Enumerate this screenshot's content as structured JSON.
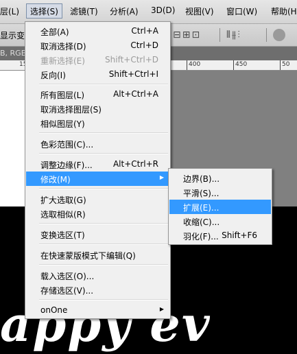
{
  "menubar": {
    "items": [
      "层(L)",
      "选择(S)",
      "滤镜(T)",
      "分析(A)",
      "3D(D)",
      "视图(V)",
      "窗口(W)",
      "帮助(H)"
    ]
  },
  "options_bar": {
    "show_transform_label": "显示变",
    "align_icons": "⊟⊞⊡",
    "distribute_icons": "⫴⫵⫶"
  },
  "document_tab": {
    "info": "B, RGB/"
  },
  "ruler": {
    "labels": [
      "15",
      "400",
      "450",
      "50"
    ]
  },
  "canvas": {
    "text_art": "appy ev"
  },
  "select_menu": {
    "items": [
      {
        "label": "全部(A)",
        "shortcut": "Ctrl+A"
      },
      {
        "label": "取消选择(D)",
        "shortcut": "Ctrl+D"
      },
      {
        "label": "重新选择(E)",
        "shortcut": "Shift+Ctrl+D",
        "disabled": true
      },
      {
        "label": "反向(I)",
        "shortcut": "Shift+Ctrl+I"
      },
      {
        "label": "所有图层(L)",
        "shortcut": "Alt+Ctrl+A"
      },
      {
        "label": "取消选择图层(S)",
        "shortcut": ""
      },
      {
        "label": "相似图层(Y)",
        "shortcut": ""
      },
      {
        "label": "色彩范围(C)...",
        "shortcut": ""
      },
      {
        "label": "调整边缘(F)...",
        "shortcut": "Alt+Ctrl+R"
      },
      {
        "label": "修改(M)",
        "shortcut": "",
        "submenu": true,
        "highlighted": true
      },
      {
        "label": "扩大选取(G)",
        "shortcut": ""
      },
      {
        "label": "选取相似(R)",
        "shortcut": ""
      },
      {
        "label": "变换选区(T)",
        "shortcut": ""
      },
      {
        "label": "在快速蒙版模式下编辑(Q)",
        "shortcut": ""
      },
      {
        "label": "载入选区(O)...",
        "shortcut": ""
      },
      {
        "label": "存储选区(V)...",
        "shortcut": ""
      },
      {
        "label": "onOne",
        "shortcut": "",
        "submenu": true
      }
    ]
  },
  "modify_submenu": {
    "items": [
      {
        "label": "边界(B)...",
        "shortcut": ""
      },
      {
        "label": "平滑(S)...",
        "shortcut": ""
      },
      {
        "label": "扩展(E)...",
        "shortcut": "",
        "highlighted": true
      },
      {
        "label": "收缩(C)...",
        "shortcut": ""
      },
      {
        "label": "羽化(F)...",
        "shortcut": "Shift+F6"
      }
    ]
  },
  "colors": {
    "highlight": "#3399ff",
    "menu_bg": "#f0f0f0",
    "disabled_text": "#9b9b9b"
  }
}
